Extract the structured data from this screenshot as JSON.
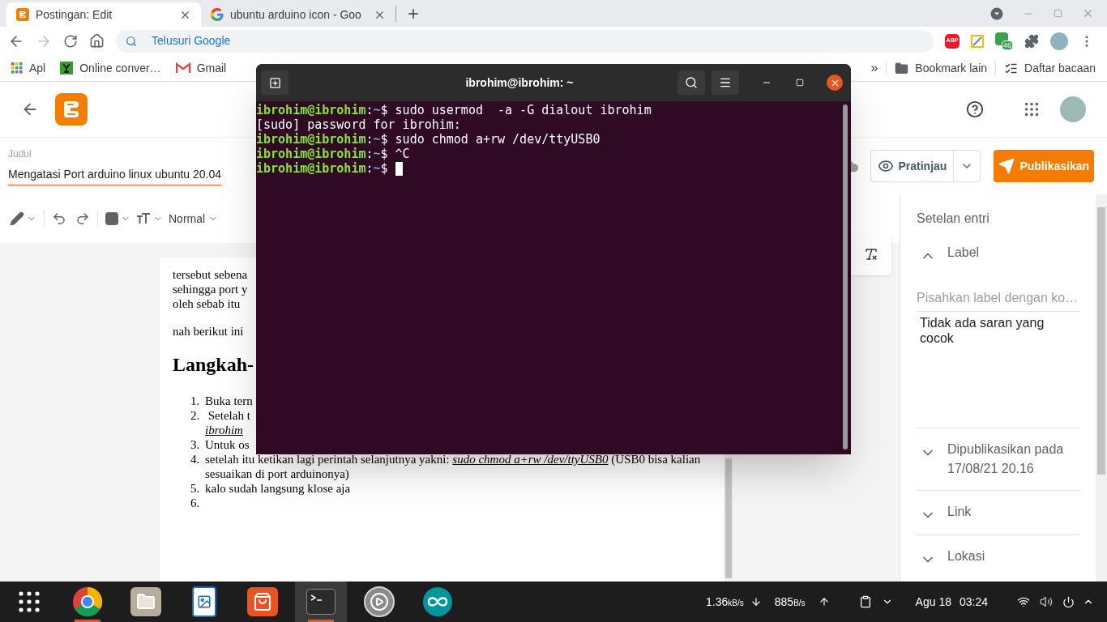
{
  "browser": {
    "tabs": [
      {
        "title": "Postingan: Edit",
        "kind": "blogger",
        "selected": true
      },
      {
        "title": "ubuntu arduino icon - Goo",
        "kind": "google",
        "selected": false
      }
    ],
    "omnibox": {
      "placeholder": "Telusuri Google"
    },
    "adblock_label": "ABP",
    "extension_badge": "46",
    "bookmarks": [
      {
        "label": "Apl",
        "kind": "apps"
      },
      {
        "label": "Online conver…",
        "kind": "converter"
      },
      {
        "label": "Gmail",
        "kind": "gmail"
      }
    ],
    "overflow": "»",
    "other_bookmarks": "Bookmark lain",
    "reading_list": "Daftar bacaan"
  },
  "editor": {
    "title_label": "Judul",
    "title": "Mengatasi Port arduino linux ubuntu 20.04",
    "preview": "Pratinjau",
    "publish": "Publikasikan",
    "paragraph_style": "Normal",
    "paragraphs": [
      [
        "tersebut sebena",
        "sehingga port y",
        "oleh sebab itu"
      ],
      [
        "nah berikut ini"
      ]
    ],
    "heading": "Langkah-",
    "steps": [
      {
        "number": "1.",
        "text": "Buka tern"
      },
      {
        "number": "2.",
        "text": " Setelah t",
        "link": "ibrohim"
      },
      {
        "number": "3.",
        "text": "Untuk os"
      },
      {
        "number": "4.",
        "text": "setelah itu ketikan lagi perintah selanjutnya yakni:",
        "link": "sudo chmod a+rw /dev/ttyUSB0",
        "after": "(USB0 bisa kalian sesuaikan di port arduinonya)"
      },
      {
        "number": "5.",
        "text": "kalo sudah langsung klose aja"
      },
      {
        "number": "6."
      }
    ]
  },
  "sidebar": {
    "title": "Setelan entri",
    "sections": [
      {
        "title": "Label",
        "expanded": true,
        "field_placeholder": "Pisahkan label dengan ko…",
        "message": "Tidak ada saran yang cocok"
      },
      {
        "title": "Dipublikasikan pada",
        "detail": "17/08/21 20.16",
        "expanded": false
      },
      {
        "title": "Link",
        "expanded": false
      },
      {
        "title": "Lokasi",
        "expanded": false
      }
    ]
  },
  "terminal": {
    "title": "ibrohim@ibrohim: ~",
    "lines": [
      {
        "kind": "prompt",
        "user": "ibrohim@ibrohim",
        "separator": ":",
        "path": "~",
        "symbol": "$",
        "command": "sudo usermod  -a -G dialout ibrohim"
      },
      {
        "kind": "output",
        "text": "[sudo] password for ibrohim:"
      },
      {
        "kind": "prompt",
        "user": "ibrohim@ibrohim",
        "separator": ":",
        "path": "~",
        "symbol": "$",
        "command": "sudo chmod a+rw /dev/ttyUSB0"
      },
      {
        "kind": "prompt",
        "user": "ibrohim@ibrohim",
        "separator": ":",
        "path": "~",
        "symbol": "$",
        "command": "^C"
      },
      {
        "kind": "prompt",
        "user": "ibrohim@ibrohim",
        "separator": ":",
        "path": "~",
        "symbol": "$",
        "cursor": true
      }
    ]
  },
  "taskbar": {
    "apps": [
      {
        "kind": "show-apps",
        "running": false,
        "selected": false
      },
      {
        "kind": "chrome",
        "running": true,
        "selected": false
      },
      {
        "kind": "files",
        "running": false,
        "selected": false
      },
      {
        "kind": "writer",
        "running": false,
        "selected": false
      },
      {
        "kind": "software",
        "running": false,
        "selected": false
      },
      {
        "kind": "terminal",
        "running": true,
        "selected": true
      },
      {
        "kind": "settings",
        "running": false,
        "selected": false
      },
      {
        "kind": "arduino",
        "running": false,
        "selected": false
      }
    ],
    "download_speed": "1.36",
    "download_unit": "kB/s",
    "upload_speed": "885",
    "upload_unit": "B/s",
    "date": "Agu 18",
    "time": "03:24"
  }
}
